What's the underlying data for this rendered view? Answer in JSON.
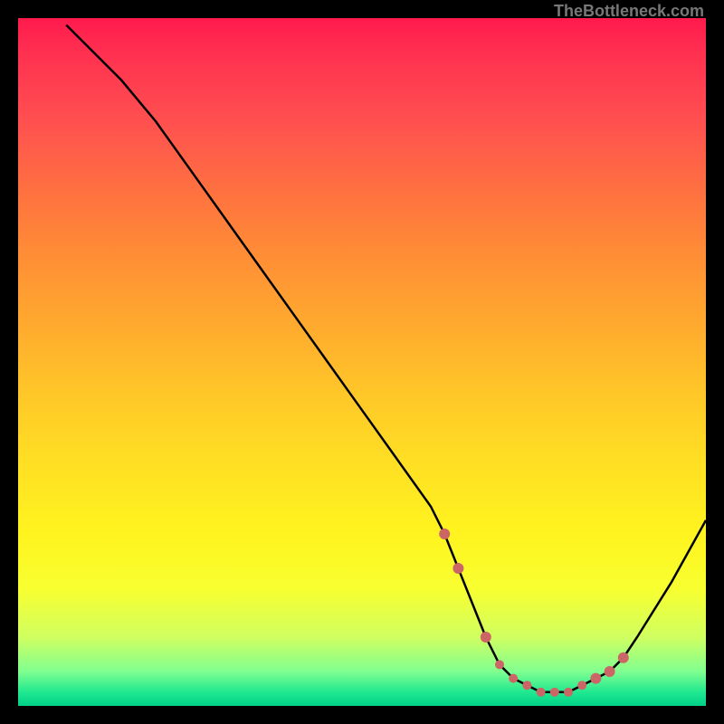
{
  "attribution": "TheBottleneck.com",
  "chart_data": {
    "type": "line",
    "title": "",
    "xlabel": "",
    "ylabel": "",
    "x_range": [
      0,
      100
    ],
    "y_range": [
      0,
      100
    ],
    "series": [
      {
        "name": "curve",
        "x": [
          7,
          10,
          15,
          20,
          25,
          30,
          35,
          40,
          45,
          50,
          55,
          60,
          62,
          64,
          66,
          68,
          70,
          72,
          74,
          76,
          78,
          80,
          82,
          84,
          86,
          88,
          90,
          95,
          100
        ],
        "y": [
          99,
          96,
          91,
          85,
          78,
          71,
          64,
          57,
          50,
          43,
          36,
          29,
          25,
          20,
          15,
          10,
          6,
          4,
          3,
          2,
          2,
          2,
          3,
          4,
          5,
          7,
          10,
          18,
          27
        ]
      }
    ],
    "highlighted_points": {
      "x": [
        62,
        64,
        68,
        70,
        72,
        74,
        76,
        78,
        80,
        82,
        84,
        86,
        88
      ],
      "y": [
        25,
        20,
        10,
        6,
        4,
        3,
        2,
        2,
        2,
        3,
        4,
        5,
        7
      ]
    },
    "colors": {
      "curve": "#000000",
      "points": "#cc6666",
      "gradient_top": "#ff1a4d",
      "gradient_bottom": "#00d088"
    }
  }
}
